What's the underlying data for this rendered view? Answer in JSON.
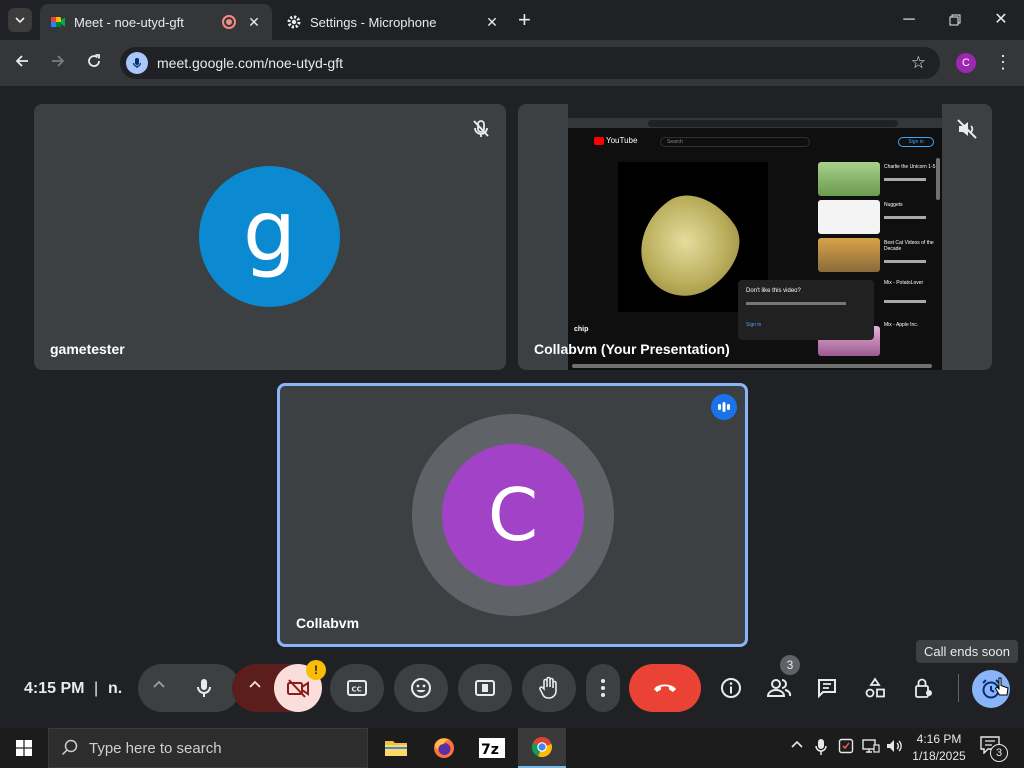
{
  "browser": {
    "tabs": [
      {
        "title": "Meet - noe-utyd-gft",
        "active": true,
        "recording": true
      },
      {
        "title": "Settings - Microphone",
        "active": false
      }
    ],
    "new_tab_label": "+",
    "url": "meet.google.com/noe-utyd-gft",
    "profile_initial": "C"
  },
  "meet": {
    "participants": [
      {
        "name": "gametester",
        "initial": "g",
        "avatar_color": "#0b8ad2",
        "muted": true
      },
      {
        "name": "Collabvm (Your Presentation)",
        "muted": true
      },
      {
        "name": "Collabvm",
        "initial": "C",
        "avatar_color": "#a142c7",
        "speaking": true
      }
    ],
    "presentation": {
      "yt_brand": "YouTube",
      "search_placeholder": "Search",
      "sign_in": "Sign in",
      "video_title": "chip",
      "popup_title": "Don't like this video?",
      "popup_action": "Sign in",
      "side_titles": [
        "Charlie the Unicorn 1-5",
        "Nuggets",
        "Best Cat Videos of the Decade",
        "Mix - PotatoLover",
        "Mix - Apple Inc."
      ]
    },
    "bottom_bar": {
      "time": "4:15 PM",
      "separator": "|",
      "meeting_code": "n.",
      "warning_badge": "!",
      "people_count": "3",
      "tooltip": "Call ends soon"
    }
  },
  "taskbar": {
    "search_placeholder": "Type here to search",
    "time": "4:16 PM",
    "date": "1/18/2025",
    "notification_count": "3",
    "apps": [
      "file-explorer",
      "firefox",
      "7zip",
      "chrome"
    ]
  },
  "colors": {
    "end_call": "#ea4335",
    "camera_off": "#f9dedc",
    "camera_off_arrow": "#8c1d18",
    "highlight_border": "#8ab4f8",
    "speaking_indicator": "#1a73e8"
  }
}
